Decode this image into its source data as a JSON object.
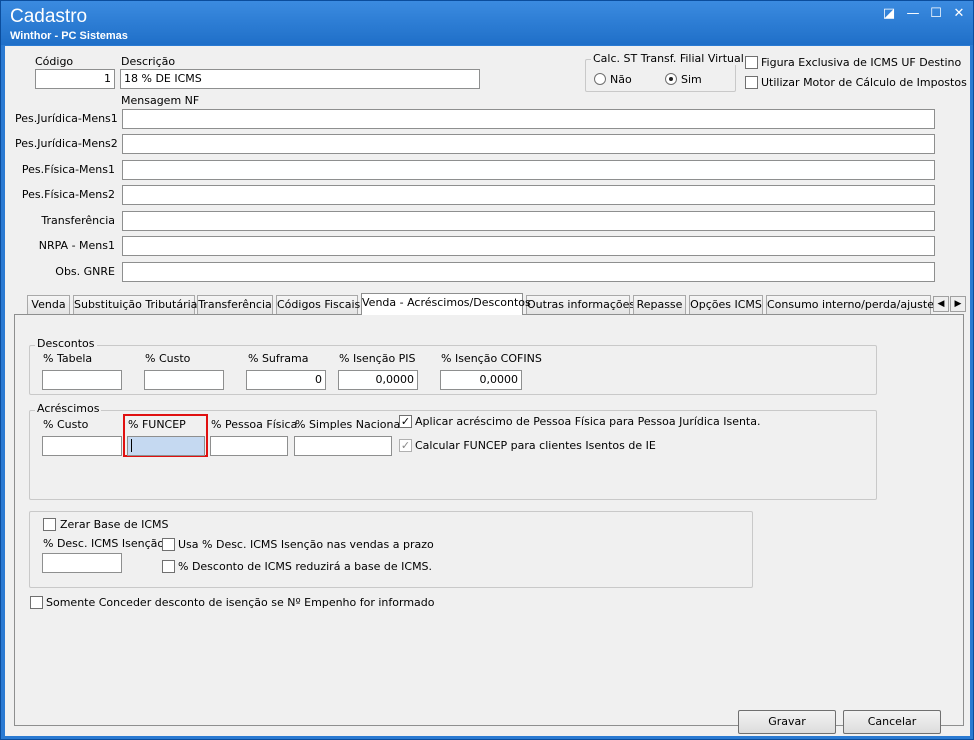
{
  "window": {
    "title": "Cadastro",
    "subtitle": "Winthor - PC Sistemas",
    "icons": [
      "restore-icon",
      "minimize-icon",
      "maximize-icon",
      "close-icon"
    ],
    "btn_restore": "◪",
    "btn_minimize": "—",
    "btn_maximize": "☐",
    "btn_close": "✕"
  },
  "header": {
    "codigo_label": "Código",
    "codigo_value": "1",
    "descricao_label": "Descrição",
    "descricao_value": "18 % DE ICMS",
    "calc_st_label": "Calc. ST Transf. Filial Virtual",
    "radio_nao": "Não",
    "radio_sim": "Sim",
    "radio_selected": "Sim",
    "figura_exclusiva": "Figura Exclusiva de ICMS UF Destino",
    "utilizar_motor": "Utilizar Motor de Cálculo de Impostos"
  },
  "mensagens": {
    "title": "Mensagem NF",
    "fields": [
      {
        "label": "Pes.Jurídica-Mens1",
        "value": ""
      },
      {
        "label": "Pes.Jurídica-Mens2",
        "value": ""
      },
      {
        "label": "Pes.Física-Mens1",
        "value": ""
      },
      {
        "label": "Pes.Física-Mens2",
        "value": ""
      },
      {
        "label": "Transferência",
        "value": ""
      },
      {
        "label": "NRPA - Mens1",
        "value": ""
      },
      {
        "label": "Obs. GNRE",
        "value": ""
      }
    ]
  },
  "tabs": [
    {
      "label": "Venda"
    },
    {
      "label": "Substituição Tributária"
    },
    {
      "label": "Transferência"
    },
    {
      "label": "Códigos Fiscais"
    },
    {
      "label": "Venda - Acréscimos/Descontos"
    },
    {
      "label": "Outras informações"
    },
    {
      "label": "Repasse"
    },
    {
      "label": "Opções ICMS"
    },
    {
      "label": "Consumo interno/perda/ajuste"
    }
  ],
  "active_tab": "Venda - Acréscimos/Descontos",
  "tab_scroll": {
    "left": "◀",
    "right": "▶"
  },
  "descontos": {
    "title": "Descontos",
    "fields": [
      {
        "label": "% Tabela",
        "value": ""
      },
      {
        "label": "% Custo",
        "value": ""
      },
      {
        "label": "% Suframa",
        "value": "0"
      },
      {
        "label": "% Isenção PIS",
        "value": "0,0000"
      },
      {
        "label": "% Isenção COFINS",
        "value": "0,0000"
      }
    ]
  },
  "acrescimos": {
    "title": "Acréscimos",
    "fields": [
      {
        "label": "% Custo",
        "value": ""
      },
      {
        "label": "% FUNCEP",
        "value": ""
      },
      {
        "label": "% Pessoa Física",
        "value": ""
      },
      {
        "label": "% Simples Nacional",
        "value": ""
      }
    ],
    "aplicar_acrescimo": "Aplicar acréscimo de Pessoa Física para Pessoa Jurídica Isenta.",
    "aplicar_checked": true,
    "calcular_funcep": "Calcular FUNCEP para clientes Isentos de IE",
    "calcular_checked": true
  },
  "zerar": {
    "zerar_base": "Zerar Base de ICMS",
    "desc_icms_label": "% Desc. ICMS Isenção",
    "desc_icms_value": "",
    "usa_desc": "Usa % Desc. ICMS Isenção nas vendas a prazo",
    "desconto_reduzira": "% Desconto de ICMS reduzirá a base de ICMS."
  },
  "somente_conceder": "Somente Conceder desconto de isenção se Nº Empenho for informado",
  "buttons": {
    "gravar": "Gravar",
    "cancelar": "Cancelar"
  },
  "colors": {
    "title_bar": "#2a7ad2",
    "highlight": "#e01010",
    "focused_input": "#c5d9f1"
  }
}
